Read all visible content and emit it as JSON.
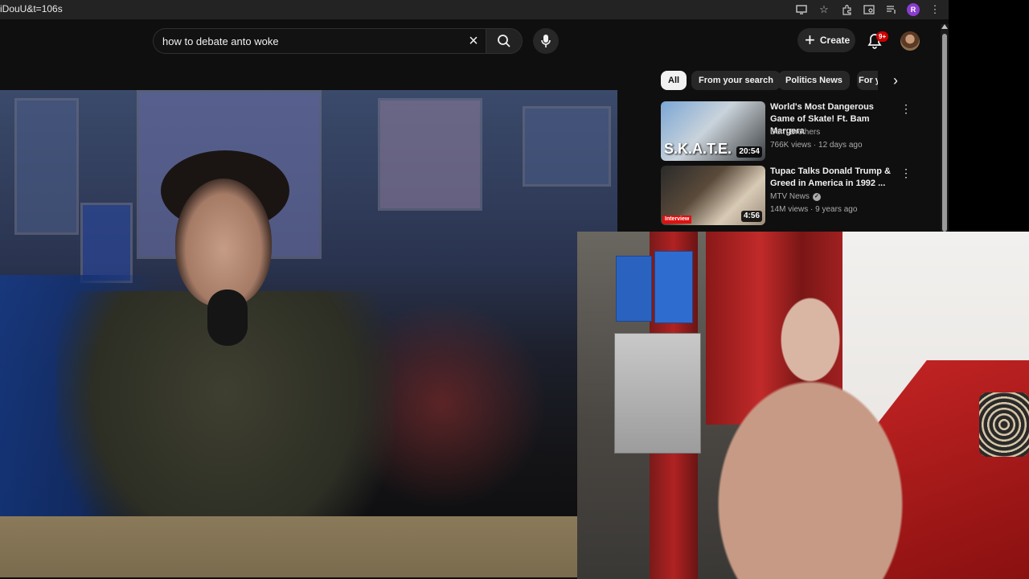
{
  "browser": {
    "url_fragment": "iDouU&t=106s",
    "profile_initial": "R",
    "icons": [
      "cast-icon",
      "star-icon",
      "extensions-icon",
      "tab-search-icon",
      "media-icon",
      "profile-icon",
      "menu-icon"
    ]
  },
  "header": {
    "search_value": "how to debate anto woke",
    "create_label": "Create",
    "notification_count": "9+"
  },
  "chips": {
    "all": "All",
    "from_search": "From your search",
    "politics": "Politics News",
    "partial": "For y"
  },
  "recommended": [
    {
      "title": "World's Most Dangerous Game of Skate! Ft. Bam Margera",
      "channel": "Dern Brothers",
      "verified": false,
      "meta": "766K views · 12 days ago",
      "duration": "20:54",
      "thumb_text": "S.K.A.T.E."
    },
    {
      "title": "Tupac Talks Donald Trump & Greed in America in 1992 ...",
      "channel": "MTV News",
      "verified": true,
      "meta": "14M views · 9 years ago",
      "duration": "4:56",
      "thumb_text": "Interview"
    }
  ],
  "colors": {
    "page_bg": "#0f0f0f",
    "chip_bg": "#272727",
    "active_chip": "#f1f1f1",
    "notification_badge": "#cc0000"
  }
}
